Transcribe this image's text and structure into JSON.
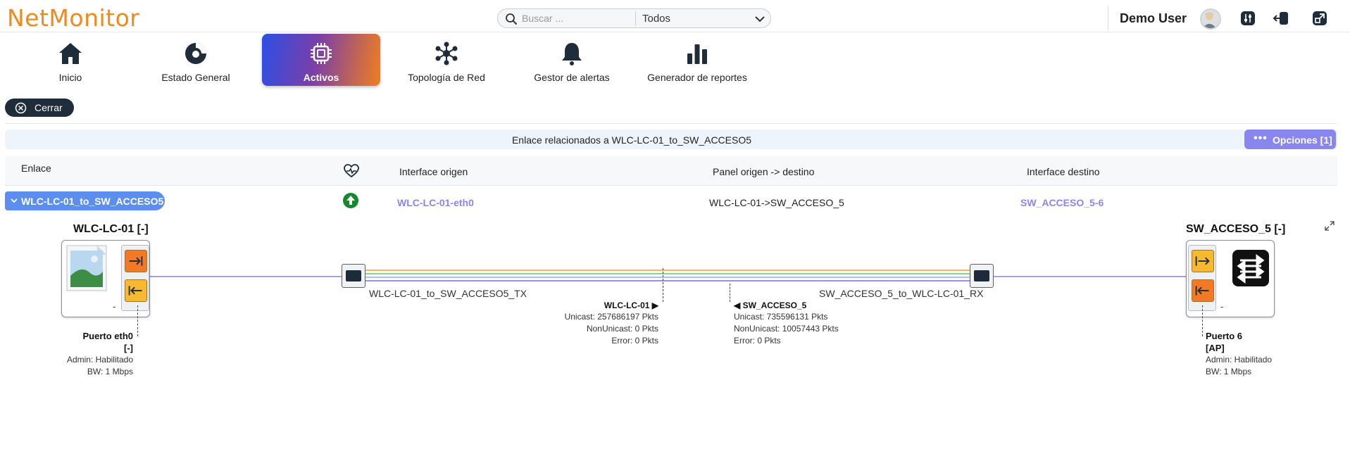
{
  "app": {
    "logo": "NetMonitor"
  },
  "search": {
    "placeholder": "Buscar ...",
    "scope": "Todos"
  },
  "user": {
    "name": "Demo User"
  },
  "nav": {
    "items": [
      {
        "label": "Inicio",
        "icon": "home-icon"
      },
      {
        "label": "Estado General",
        "icon": "gauge-icon"
      },
      {
        "label": "Activos",
        "icon": "chip-icon",
        "active": true
      },
      {
        "label": "Topología de Red",
        "icon": "topology-icon"
      },
      {
        "label": "Gestor de alertas",
        "icon": "bell-icon"
      },
      {
        "label": "Generador de reportes",
        "icon": "bar-chart-icon"
      }
    ]
  },
  "close_button": {
    "label": "Cerrar"
  },
  "link_panel": {
    "title": "Enlace relacionados a WLC-LC-01_to_SW_ACCESO5",
    "options_label": "Opciones [1]"
  },
  "table": {
    "headers": {
      "link": "Enlace",
      "status_icon": "heart-pulse-icon",
      "iface_origin": "Interface origen",
      "panel": "Panel origen -> destino",
      "iface_dest": "Interface destino"
    },
    "rows": [
      {
        "link": "WLC-LC-01_to_SW_ACCESO5",
        "status": "up",
        "iface_origin": "WLC-LC-01-eth0",
        "panel": "WLC-LC-01->SW_ACCESO_5",
        "iface_dest": "SW_ACCESO_5-6"
      }
    ]
  },
  "diagram": {
    "left_device": {
      "title": "WLC-LC-01 [-]",
      "dash": "-",
      "port_name": "Puerto eth0",
      "port_tag": "[-]",
      "admin": "Admin: Habilitado",
      "bw": "BW: 1 Mbps"
    },
    "right_device": {
      "title": "SW_ACCESO_5 [-]",
      "dash": "-",
      "port_name": "Puerto 6",
      "port_tag": "[AP]",
      "admin": "Admin: Habilitado",
      "bw": "BW: 1 Mbps"
    },
    "tx_label": "WLC-LC-01_to_SW_ACCESO5_TX",
    "rx_label": "SW_ACCESO_5_to_WLC-LC-01_RX",
    "left_stats": {
      "title": "WLC-LC-01 ▶",
      "unicast": "Unicast: 257686197 Pkts",
      "nonunicast": "NonUnicast: 0 Pkts",
      "error": "Error: 0 Pkts"
    },
    "right_stats": {
      "title": "◀ SW_ACCESO_5",
      "unicast": "Unicast: 735596131 Pkts",
      "nonunicast": "NonUnicast: 10057443 Pkts",
      "error": "Error: 0 Pkts"
    },
    "cable_colors": [
      "#f2b36b",
      "#8fd07a",
      "#9fc6ef",
      "#9a8fe0"
    ],
    "link_line_color": "#8a80d8"
  }
}
